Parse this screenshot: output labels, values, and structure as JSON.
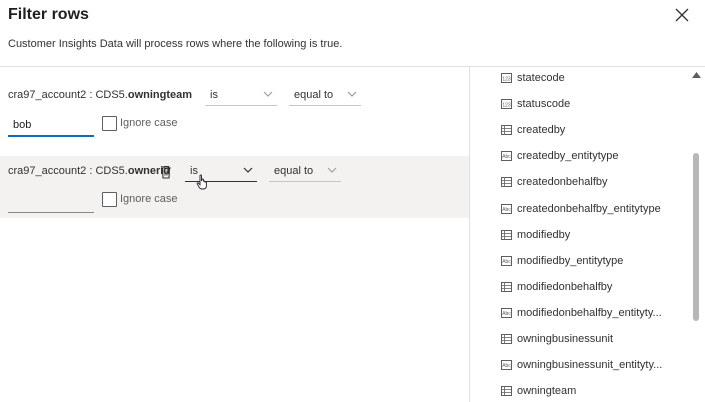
{
  "dialog": {
    "title": "Filter rows",
    "subtitle": "Customer Insights Data will process rows where the following is true."
  },
  "conditions": [
    {
      "field_entity": "cra97_account2 : CDS5.",
      "field_attr": "owningteam",
      "operator": "is",
      "comparison": "equal to",
      "value": "bob",
      "ignore_case_label": "Ignore case"
    },
    {
      "field_entity": "cra97_account2 : CDS5.",
      "field_attr": "ownerid",
      "operator": "is",
      "comparison": "equal to",
      "value": "",
      "ignore_case_label": "Ignore case"
    }
  ],
  "column_list": [
    {
      "icon": "option-set-icon",
      "label": "statecode"
    },
    {
      "icon": "option-set-icon",
      "label": "statuscode"
    },
    {
      "icon": "lookup-icon",
      "label": "createdby"
    },
    {
      "icon": "text-field-icon",
      "label": "createdby_entitytype"
    },
    {
      "icon": "lookup-icon",
      "label": "createdonbehalfby"
    },
    {
      "icon": "text-field-icon",
      "label": "createdonbehalfby_entitytype"
    },
    {
      "icon": "lookup-icon",
      "label": "modifiedby"
    },
    {
      "icon": "text-field-icon",
      "label": "modifiedby_entitytype"
    },
    {
      "icon": "lookup-icon",
      "label": "modifiedonbehalfby"
    },
    {
      "icon": "text-field-icon",
      "label": "modifiedonbehalfby_entityty..."
    },
    {
      "icon": "lookup-icon",
      "label": "owningbusinessunit"
    },
    {
      "icon": "text-field-icon",
      "label": "owningbusinessunit_entityty..."
    },
    {
      "icon": "lookup-icon",
      "label": "owningteam"
    }
  ],
  "colors": {
    "accent": "#0f6cbd",
    "row_highlight": "#f3f2f1",
    "divider": "#e1dfdd",
    "scrollbar": "#b7b7b7"
  }
}
